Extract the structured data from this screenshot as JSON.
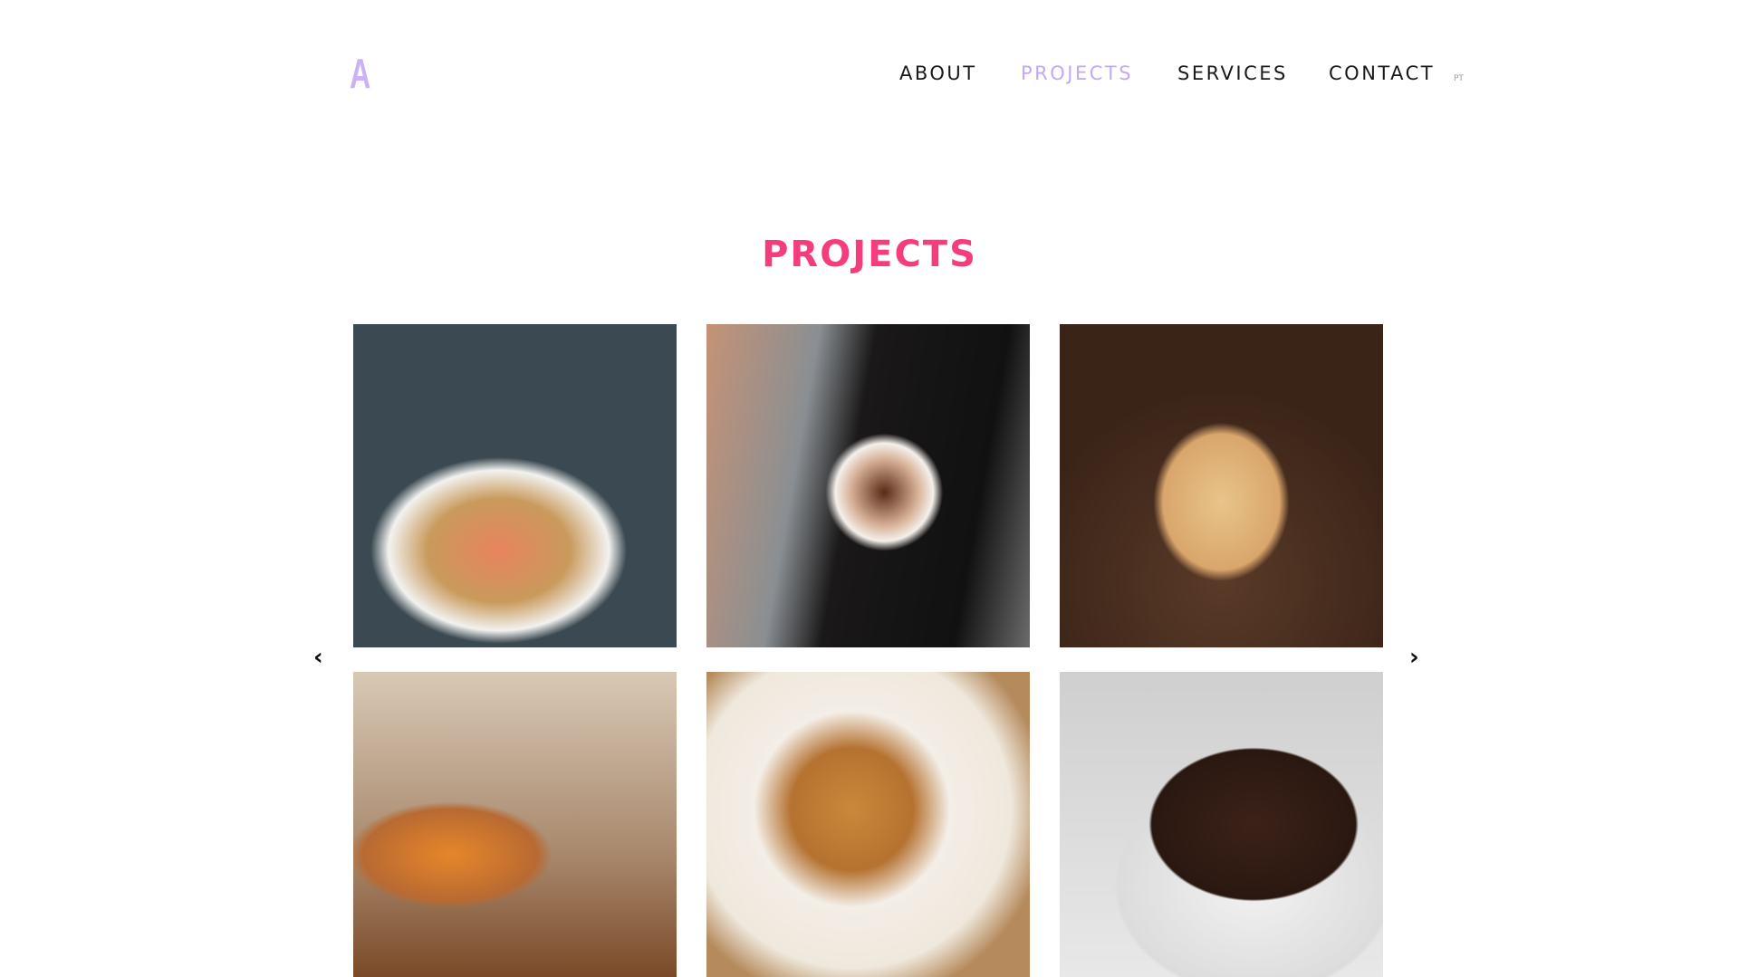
{
  "logo": "A",
  "nav": {
    "items": [
      {
        "label": "ABOUT"
      },
      {
        "label": "PROJECTS",
        "active": true
      },
      {
        "label": "SERVICES"
      },
      {
        "label": "CONTACT"
      }
    ],
    "lang": "PT"
  },
  "section": {
    "title": "PROJECTS"
  },
  "colors": {
    "accent": "#f53d7e",
    "nav_active": "#c3a9f5",
    "logo": "#c9b2f7"
  },
  "gallery": {
    "prev_icon": "chevron-left-icon",
    "next_icon": "chevron-right-icon",
    "prev_glyph": "‹",
    "next_glyph": "›"
  }
}
